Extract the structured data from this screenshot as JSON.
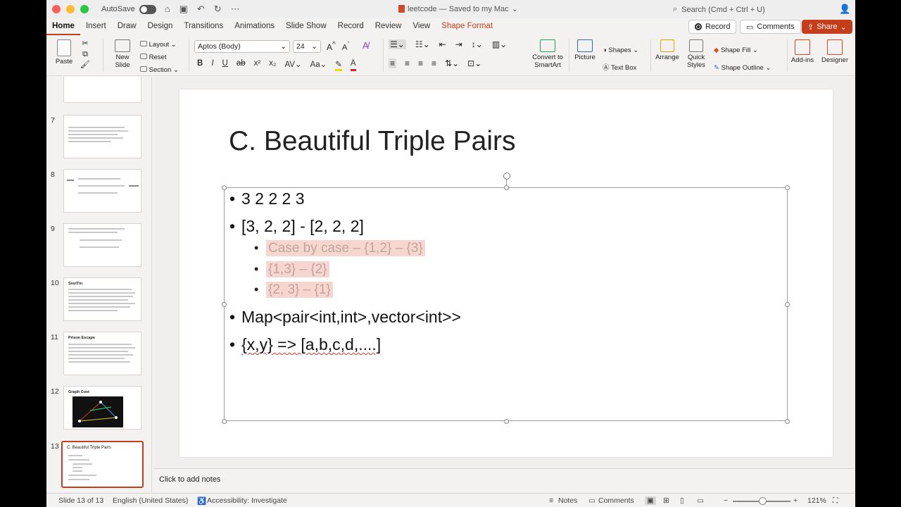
{
  "titlebar": {
    "autosave": "AutoSave",
    "doc_title": "leetcode — Saved to my Mac",
    "search_placeholder": "Search (Cmd + Ctrl + U)"
  },
  "tabs": [
    "Home",
    "Insert",
    "Draw",
    "Design",
    "Transitions",
    "Animations",
    "Slide Show",
    "Record",
    "Review",
    "View",
    "Shape Format"
  ],
  "tab_buttons": {
    "record": "Record",
    "comments": "Comments",
    "share": "Share"
  },
  "ribbon": {
    "paste": "Paste",
    "new_slide_1": "New",
    "new_slide_2": "Slide",
    "layout": "Layout",
    "reset": "Reset",
    "section": "Section",
    "font": "Aptos (Body)",
    "size": "24",
    "convert_1": "Convert to",
    "convert_2": "SmartArt",
    "picture": "Picture",
    "shapes": "Shapes",
    "text_box": "Text Box",
    "arrange": "Arrange",
    "quick_1": "Quick",
    "quick_2": "Styles",
    "shape_fill": "Shape Fill",
    "shape_outline": "Shape Outline",
    "addins": "Add-ins",
    "designer": "Designer"
  },
  "thumbnails": [
    {
      "num": "7",
      "title": ""
    },
    {
      "num": "8",
      "title": ""
    },
    {
      "num": "9",
      "title": ""
    },
    {
      "num": "10",
      "title": "SoulTin"
    },
    {
      "num": "11",
      "title": "Prison Escape"
    },
    {
      "num": "12",
      "title": "Graph Cost"
    },
    {
      "num": "13",
      "title": "C. Beautiful Triple Pairs"
    }
  ],
  "slide": {
    "title": "C. Beautiful Triple Pairs",
    "bullets": [
      {
        "text": "3 2 2 2 3"
      },
      {
        "text": "[3, 2, 2]  - [2, 2, 2]"
      },
      {
        "text": "Map<pair<int,int>,vector<int>>"
      },
      {
        "text": "{x,y} => [a,b,c,d,....]"
      }
    ],
    "sub_bullets": [
      {
        "text": "Case by case – {1,2} – {3}"
      },
      {
        "text": "{1,3} – {2}"
      },
      {
        "text": "{2, 3} – {1}"
      }
    ]
  },
  "notes_placeholder": "Click to add notes",
  "status": {
    "slide": "Slide 13 of 13",
    "language": "English (United States)",
    "accessibility": "Accessibility: Investigate",
    "notes": "Notes",
    "comments": "Comments",
    "zoom": "121%"
  },
  "colors": {
    "accent": "#c43e1c",
    "highlight": "#f6d6cf"
  }
}
